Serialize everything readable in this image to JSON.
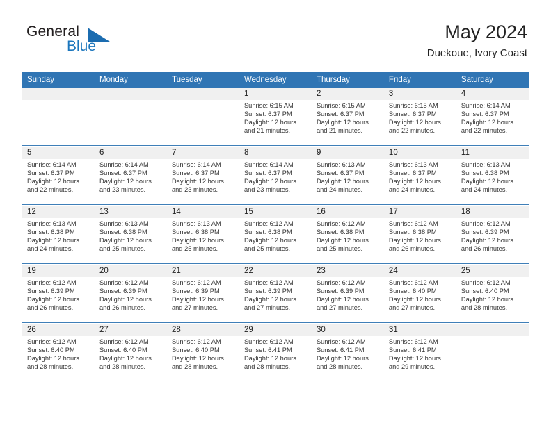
{
  "brand": {
    "name_part1": "General",
    "name_part2": "Blue",
    "triangle_icon": "triangle-icon",
    "accent_color": "#1b6cb0"
  },
  "header": {
    "title": "May 2024",
    "subtitle": "Duekoue, Ivory Coast"
  },
  "colors": {
    "header_blue": "#3075b4",
    "separator_blue": "#3f7fb8",
    "daynum_bg": "#f0f0f0",
    "text": "#222222"
  },
  "weekday_headers": [
    "Sunday",
    "Monday",
    "Tuesday",
    "Wednesday",
    "Thursday",
    "Friday",
    "Saturday"
  ],
  "labels": {
    "sunrise": "Sunrise:",
    "sunset": "Sunset:",
    "daylight": "Daylight:"
  },
  "weeks": [
    {
      "days": [
        {
          "num": "",
          "l1": "",
          "l2": "",
          "l3": "",
          "l4": ""
        },
        {
          "num": "",
          "l1": "",
          "l2": "",
          "l3": "",
          "l4": ""
        },
        {
          "num": "",
          "l1": "",
          "l2": "",
          "l3": "",
          "l4": ""
        },
        {
          "num": "1",
          "l1": "Sunrise: 6:15 AM",
          "l2": "Sunset: 6:37 PM",
          "l3": "Daylight: 12 hours",
          "l4": "and 21 minutes."
        },
        {
          "num": "2",
          "l1": "Sunrise: 6:15 AM",
          "l2": "Sunset: 6:37 PM",
          "l3": "Daylight: 12 hours",
          "l4": "and 21 minutes."
        },
        {
          "num": "3",
          "l1": "Sunrise: 6:15 AM",
          "l2": "Sunset: 6:37 PM",
          "l3": "Daylight: 12 hours",
          "l4": "and 22 minutes."
        },
        {
          "num": "4",
          "l1": "Sunrise: 6:14 AM",
          "l2": "Sunset: 6:37 PM",
          "l3": "Daylight: 12 hours",
          "l4": "and 22 minutes."
        }
      ]
    },
    {
      "days": [
        {
          "num": "5",
          "l1": "Sunrise: 6:14 AM",
          "l2": "Sunset: 6:37 PM",
          "l3": "Daylight: 12 hours",
          "l4": "and 22 minutes."
        },
        {
          "num": "6",
          "l1": "Sunrise: 6:14 AM",
          "l2": "Sunset: 6:37 PM",
          "l3": "Daylight: 12 hours",
          "l4": "and 23 minutes."
        },
        {
          "num": "7",
          "l1": "Sunrise: 6:14 AM",
          "l2": "Sunset: 6:37 PM",
          "l3": "Daylight: 12 hours",
          "l4": "and 23 minutes."
        },
        {
          "num": "8",
          "l1": "Sunrise: 6:14 AM",
          "l2": "Sunset: 6:37 PM",
          "l3": "Daylight: 12 hours",
          "l4": "and 23 minutes."
        },
        {
          "num": "9",
          "l1": "Sunrise: 6:13 AM",
          "l2": "Sunset: 6:37 PM",
          "l3": "Daylight: 12 hours",
          "l4": "and 24 minutes."
        },
        {
          "num": "10",
          "l1": "Sunrise: 6:13 AM",
          "l2": "Sunset: 6:37 PM",
          "l3": "Daylight: 12 hours",
          "l4": "and 24 minutes."
        },
        {
          "num": "11",
          "l1": "Sunrise: 6:13 AM",
          "l2": "Sunset: 6:38 PM",
          "l3": "Daylight: 12 hours",
          "l4": "and 24 minutes."
        }
      ]
    },
    {
      "days": [
        {
          "num": "12",
          "l1": "Sunrise: 6:13 AM",
          "l2": "Sunset: 6:38 PM",
          "l3": "Daylight: 12 hours",
          "l4": "and 24 minutes."
        },
        {
          "num": "13",
          "l1": "Sunrise: 6:13 AM",
          "l2": "Sunset: 6:38 PM",
          "l3": "Daylight: 12 hours",
          "l4": "and 25 minutes."
        },
        {
          "num": "14",
          "l1": "Sunrise: 6:13 AM",
          "l2": "Sunset: 6:38 PM",
          "l3": "Daylight: 12 hours",
          "l4": "and 25 minutes."
        },
        {
          "num": "15",
          "l1": "Sunrise: 6:12 AM",
          "l2": "Sunset: 6:38 PM",
          "l3": "Daylight: 12 hours",
          "l4": "and 25 minutes."
        },
        {
          "num": "16",
          "l1": "Sunrise: 6:12 AM",
          "l2": "Sunset: 6:38 PM",
          "l3": "Daylight: 12 hours",
          "l4": "and 25 minutes."
        },
        {
          "num": "17",
          "l1": "Sunrise: 6:12 AM",
          "l2": "Sunset: 6:38 PM",
          "l3": "Daylight: 12 hours",
          "l4": "and 26 minutes."
        },
        {
          "num": "18",
          "l1": "Sunrise: 6:12 AM",
          "l2": "Sunset: 6:39 PM",
          "l3": "Daylight: 12 hours",
          "l4": "and 26 minutes."
        }
      ]
    },
    {
      "days": [
        {
          "num": "19",
          "l1": "Sunrise: 6:12 AM",
          "l2": "Sunset: 6:39 PM",
          "l3": "Daylight: 12 hours",
          "l4": "and 26 minutes."
        },
        {
          "num": "20",
          "l1": "Sunrise: 6:12 AM",
          "l2": "Sunset: 6:39 PM",
          "l3": "Daylight: 12 hours",
          "l4": "and 26 minutes."
        },
        {
          "num": "21",
          "l1": "Sunrise: 6:12 AM",
          "l2": "Sunset: 6:39 PM",
          "l3": "Daylight: 12 hours",
          "l4": "and 27 minutes."
        },
        {
          "num": "22",
          "l1": "Sunrise: 6:12 AM",
          "l2": "Sunset: 6:39 PM",
          "l3": "Daylight: 12 hours",
          "l4": "and 27 minutes."
        },
        {
          "num": "23",
          "l1": "Sunrise: 6:12 AM",
          "l2": "Sunset: 6:39 PM",
          "l3": "Daylight: 12 hours",
          "l4": "and 27 minutes."
        },
        {
          "num": "24",
          "l1": "Sunrise: 6:12 AM",
          "l2": "Sunset: 6:40 PM",
          "l3": "Daylight: 12 hours",
          "l4": "and 27 minutes."
        },
        {
          "num": "25",
          "l1": "Sunrise: 6:12 AM",
          "l2": "Sunset: 6:40 PM",
          "l3": "Daylight: 12 hours",
          "l4": "and 28 minutes."
        }
      ]
    },
    {
      "days": [
        {
          "num": "26",
          "l1": "Sunrise: 6:12 AM",
          "l2": "Sunset: 6:40 PM",
          "l3": "Daylight: 12 hours",
          "l4": "and 28 minutes."
        },
        {
          "num": "27",
          "l1": "Sunrise: 6:12 AM",
          "l2": "Sunset: 6:40 PM",
          "l3": "Daylight: 12 hours",
          "l4": "and 28 minutes."
        },
        {
          "num": "28",
          "l1": "Sunrise: 6:12 AM",
          "l2": "Sunset: 6:40 PM",
          "l3": "Daylight: 12 hours",
          "l4": "and 28 minutes."
        },
        {
          "num": "29",
          "l1": "Sunrise: 6:12 AM",
          "l2": "Sunset: 6:41 PM",
          "l3": "Daylight: 12 hours",
          "l4": "and 28 minutes."
        },
        {
          "num": "30",
          "l1": "Sunrise: 6:12 AM",
          "l2": "Sunset: 6:41 PM",
          "l3": "Daylight: 12 hours",
          "l4": "and 28 minutes."
        },
        {
          "num": "31",
          "l1": "Sunrise: 6:12 AM",
          "l2": "Sunset: 6:41 PM",
          "l3": "Daylight: 12 hours",
          "l4": "and 29 minutes."
        },
        {
          "num": "",
          "l1": "",
          "l2": "",
          "l3": "",
          "l4": ""
        }
      ]
    }
  ]
}
